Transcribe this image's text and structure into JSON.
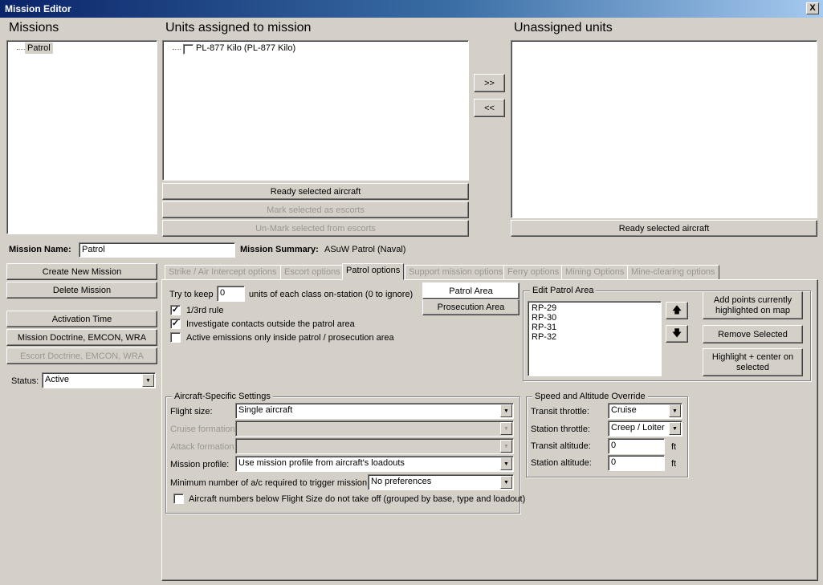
{
  "window": {
    "title": "Mission Editor",
    "close_label": "X"
  },
  "missions": {
    "header": "Missions",
    "items": [
      "Patrol"
    ]
  },
  "assigned": {
    "header": "Units assigned to mission",
    "units": [
      "PL-877 Kilo (PL-877 Kilo)"
    ],
    "ready_label": "Ready selected aircraft",
    "mark_label": "Mark selected as escorts",
    "unmark_label": "Un-Mark selected from escorts"
  },
  "transfer": {
    "add_label": ">>",
    "remove_label": "<<"
  },
  "unassigned": {
    "header": "Unassigned units",
    "ready_label": "Ready selected aircraft"
  },
  "mission_info": {
    "name_label": "Mission Name:",
    "name_value": "Patrol",
    "summary_label": "Mission Summary:",
    "summary_value": "ASuW Patrol (Naval)"
  },
  "left_buttons": {
    "create": "Create New Mission",
    "delete": "Delete Mission",
    "activation": "Activation Time",
    "doctrine": "Mission Doctrine, EMCON, WRA",
    "escort_doctrine": "Escort Doctrine, EMCON, WRA"
  },
  "status": {
    "label": "Status:",
    "value": "Active"
  },
  "tabs": [
    "Strike / Air Intercept options",
    "Escort options",
    "Patrol options",
    "Support mission options",
    "Ferry options",
    "Mining Options",
    "Mine-clearing options"
  ],
  "patrol": {
    "keep_prefix": "Try to keep",
    "keep_value": "0",
    "keep_suffix": "units of each class on-station (0 to ignore)",
    "rule_third": {
      "label": "1/3rd rule",
      "checked": true
    },
    "investigate": {
      "label": "Investigate contacts outside the patrol area",
      "checked": true
    },
    "active_emissions": {
      "label": "Active emissions only inside patrol / prosecution area",
      "checked": false
    },
    "area_buttons": {
      "patrol": "Patrol Area",
      "prosecution": "Prosecution Area"
    },
    "edit_area": {
      "title": "Edit Patrol Area",
      "points": [
        "RP-29",
        "RP-30",
        "RP-31",
        "RP-32"
      ],
      "add_points": "Add points currently highlighted on map",
      "remove": "Remove Selected",
      "highlight": "Highlight + center on selected"
    }
  },
  "aircraft_settings": {
    "title": "Aircraft-Specific Settings",
    "flight_size": {
      "label": "Flight size:",
      "value": "Single aircraft"
    },
    "cruise_formation": {
      "label": "Cruise formation:",
      "value": ""
    },
    "attack_formation": {
      "label": "Attack formation:",
      "value": ""
    },
    "mission_profile": {
      "label": "Mission profile:",
      "value": "Use mission profile from aircraft's loadouts"
    },
    "min_aircraft": {
      "label": "Minimum number of a/c required to trigger mission:",
      "value": "No preferences"
    },
    "below_flight_size": {
      "label": "Aircraft numbers below Flight Size do not take off (grouped by base, type and loadout)",
      "checked": false
    }
  },
  "speed_altitude": {
    "title": "Speed and Altitude Override",
    "transit_throttle": {
      "label": "Transit throttle:",
      "value": "Cruise"
    },
    "station_throttle": {
      "label": "Station throttle:",
      "value": "Creep / Loiter"
    },
    "transit_altitude": {
      "label": "Transit altitude:",
      "value": "0",
      "unit": "ft"
    },
    "station_altitude": {
      "label": "Station altitude:",
      "value": "0",
      "unit": "ft"
    }
  },
  "icons": {
    "dropdown": "chevron-down-icon",
    "up": "arrow-up-icon",
    "down": "arrow-down-icon",
    "check": "check-icon"
  }
}
